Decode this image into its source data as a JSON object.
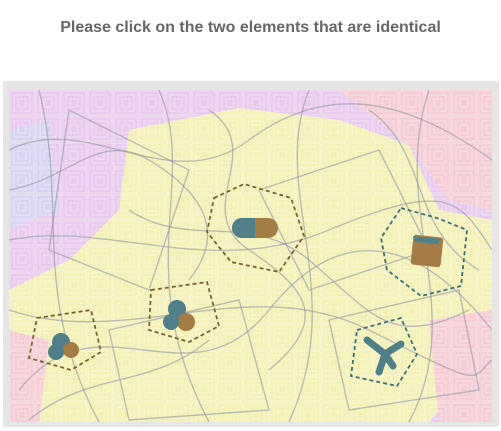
{
  "instruction": "Please click on the two elements that are identical",
  "colors": {
    "text": "#666666",
    "frame": "#e6e6e6",
    "background_regions": [
      "#e9cbef",
      "#f4f1b6",
      "#f6cdd5",
      "#d8d4f1"
    ],
    "scribble": "#8a8fa0",
    "dash_teal": "#3e6e78",
    "dash_brown": "#7a6230",
    "blob_teal": "#4f7f88",
    "blob_brown": "#a57c45"
  },
  "puzzle": {
    "elements": [
      {
        "id": "e1",
        "shape": "pill",
        "description": "teal-brown capsule"
      },
      {
        "id": "e2",
        "shape": "rounded-square",
        "description": "brown square with teal edge"
      },
      {
        "id": "e3",
        "shape": "trefoil",
        "description": "teal/brown three-lobed blob"
      },
      {
        "id": "e4",
        "shape": "trefoil",
        "description": "teal/brown three-lobed blob"
      },
      {
        "id": "e5",
        "shape": "x-cross",
        "description": "teal x-shaped cross"
      }
    ]
  }
}
